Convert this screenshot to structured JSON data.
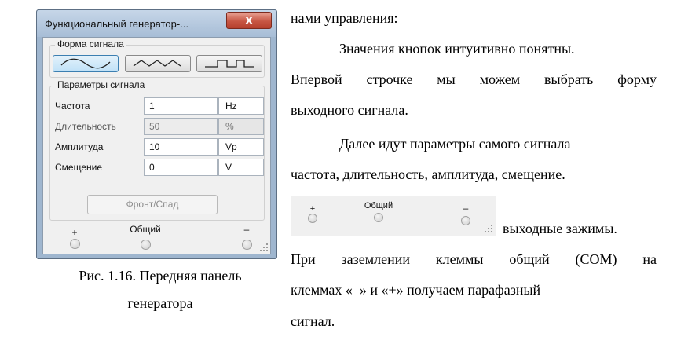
{
  "window": {
    "title": "Функциональный генератор-...",
    "close_glyph": "x",
    "shape_group_label": "Форма сигнала",
    "shape_buttons": [
      {
        "name": "sine-wave-icon",
        "active": true
      },
      {
        "name": "triangle-wave-icon",
        "active": false
      },
      {
        "name": "square-wave-icon",
        "active": false
      }
    ],
    "params_group_label": "Параметры сигнала",
    "params": [
      {
        "label": "Частота",
        "value": "1",
        "unit": "Hz",
        "disabled": false
      },
      {
        "label": "Длительность",
        "value": "50",
        "unit": "%",
        "disabled": true
      },
      {
        "label": "Амплитуда",
        "value": "10",
        "unit": "Vp",
        "disabled": false
      },
      {
        "label": "Смещение",
        "value": "0",
        "unit": "V",
        "disabled": false
      }
    ],
    "edge_button": "Фронт/Спад",
    "terminals": {
      "plus": "+",
      "common": "Общий",
      "minus": "–"
    }
  },
  "caption": {
    "line1": "Рис. 1.16. Передняя панель",
    "line2": "генератора"
  },
  "text": {
    "l1": "нами управления:",
    "l2": "Значения кнопок интуитивно понятны.",
    "l3": "Впервой строчке мы можем выбрать форму",
    "l4": "выходного сигнала.",
    "l5": "Далее идут параметры самого сигнала –",
    "l6": "частота, длительность, амплитуда, смещение.",
    "l7": "выходные зажимы.",
    "l8": "При заземлении клеммы общий (COM) на",
    "l9": "клеммах «–» и «+» получаем парафазный",
    "l10": "сигнал."
  },
  "strip": {
    "plus": "+",
    "common": "Общий",
    "minus": "–"
  },
  "colors": {
    "titlebar": "#a7bdd6",
    "close_button": "#c75643",
    "active_shape_button": "#bfe1f7"
  }
}
